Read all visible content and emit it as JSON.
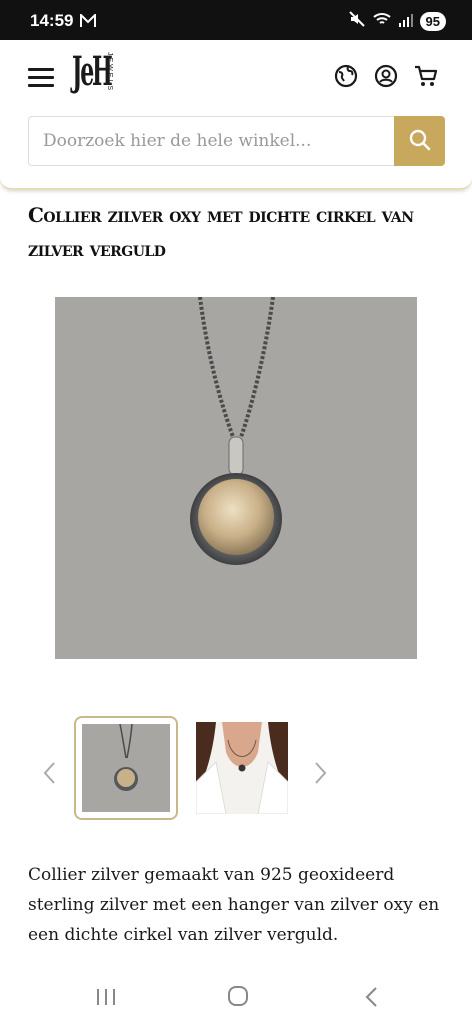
{
  "status_bar": {
    "time": "14:59",
    "battery": "95",
    "icons": [
      "mail-icon",
      "mute-icon",
      "wifi-icon",
      "signal-icon"
    ]
  },
  "header": {
    "logo_mark": "JeH",
    "logo_word": "JEWELS",
    "icons": [
      "menu-icon",
      "globe-icon",
      "account-icon",
      "cart-icon"
    ],
    "search": {
      "placeholder": "Doorzoek hier de hele winkel...",
      "value": ""
    }
  },
  "product": {
    "title": "Collier zilver oxy met dichte cirkel van zilver verguld",
    "description": "Collier zilver gemaakt van 925 geoxideerd sterling zilver met een hanger van zilver oxy en een dichte cirkel van zilver verguld.",
    "thumbnails": [
      "pendant-closeup",
      "pendant-worn"
    ],
    "selected_thumbnail": 0
  },
  "colors": {
    "accent": "#c8a85d",
    "photo_background": "#a8a6a3",
    "status_bar": "#111111"
  },
  "nav_bar": [
    "recents-icon",
    "home-icon",
    "back-icon"
  ]
}
